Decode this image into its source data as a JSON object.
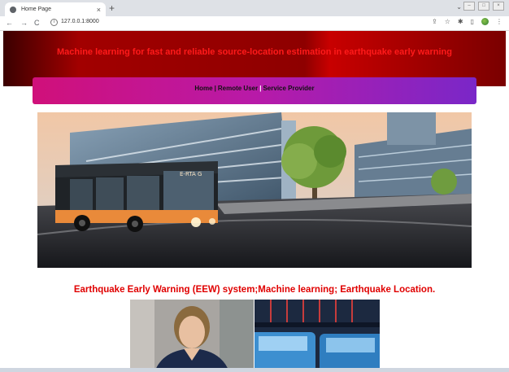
{
  "browser": {
    "tab_title": "Home Page",
    "tab_close": "×",
    "new_tab": "+",
    "url": "127.0.0.1:8000"
  },
  "header": {
    "title": "Machine learning for fast and reliable source-location estimation in earthquake early warning"
  },
  "nav": {
    "home": "Home",
    "sep1": "|",
    "remote_user": "Remote User",
    "sep2": "|",
    "service_provider": "Service Provider"
  },
  "banner": {
    "bus_sign": "E-RTA G"
  },
  "caption": {
    "text": "Earthquake Early Warning (EEW) system;Machine learning; Earthquake Location."
  },
  "colors": {
    "title_red": "#ff1a1a",
    "caption_red": "#e00000",
    "nav_gradient_start": "#d0107a",
    "nav_gradient_end": "#7a27c8"
  }
}
